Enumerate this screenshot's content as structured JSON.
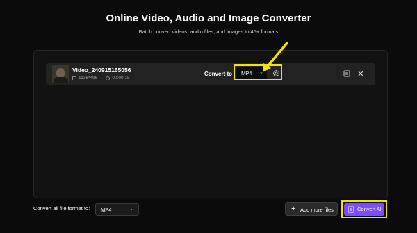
{
  "header": {
    "title": "Online Video, Audio and Image Converter",
    "subtitle": "Batch convert videos, audio files, and images to 45+ formats"
  },
  "file": {
    "name": "Video_240915165056",
    "resolution": "1136*496",
    "duration": "00:00:15",
    "convert_to_label": "Convert to",
    "format": "MP4"
  },
  "footer": {
    "convert_all_label": "Convert all file format to:",
    "convert_all_format": "MP4",
    "add_more_label": "Add more files",
    "convert_all_button": "Convert All"
  },
  "colors": {
    "accent": "#7c4dff",
    "highlight": "#f2e600",
    "background": "#0b0b0b"
  },
  "icons": [
    "file-thumbnail",
    "resolution-icon",
    "clock-icon",
    "chevron-down-icon",
    "gear-icon",
    "compress-icon",
    "close-icon",
    "plus-icon",
    "convert-icon",
    "arrow-pointer"
  ]
}
